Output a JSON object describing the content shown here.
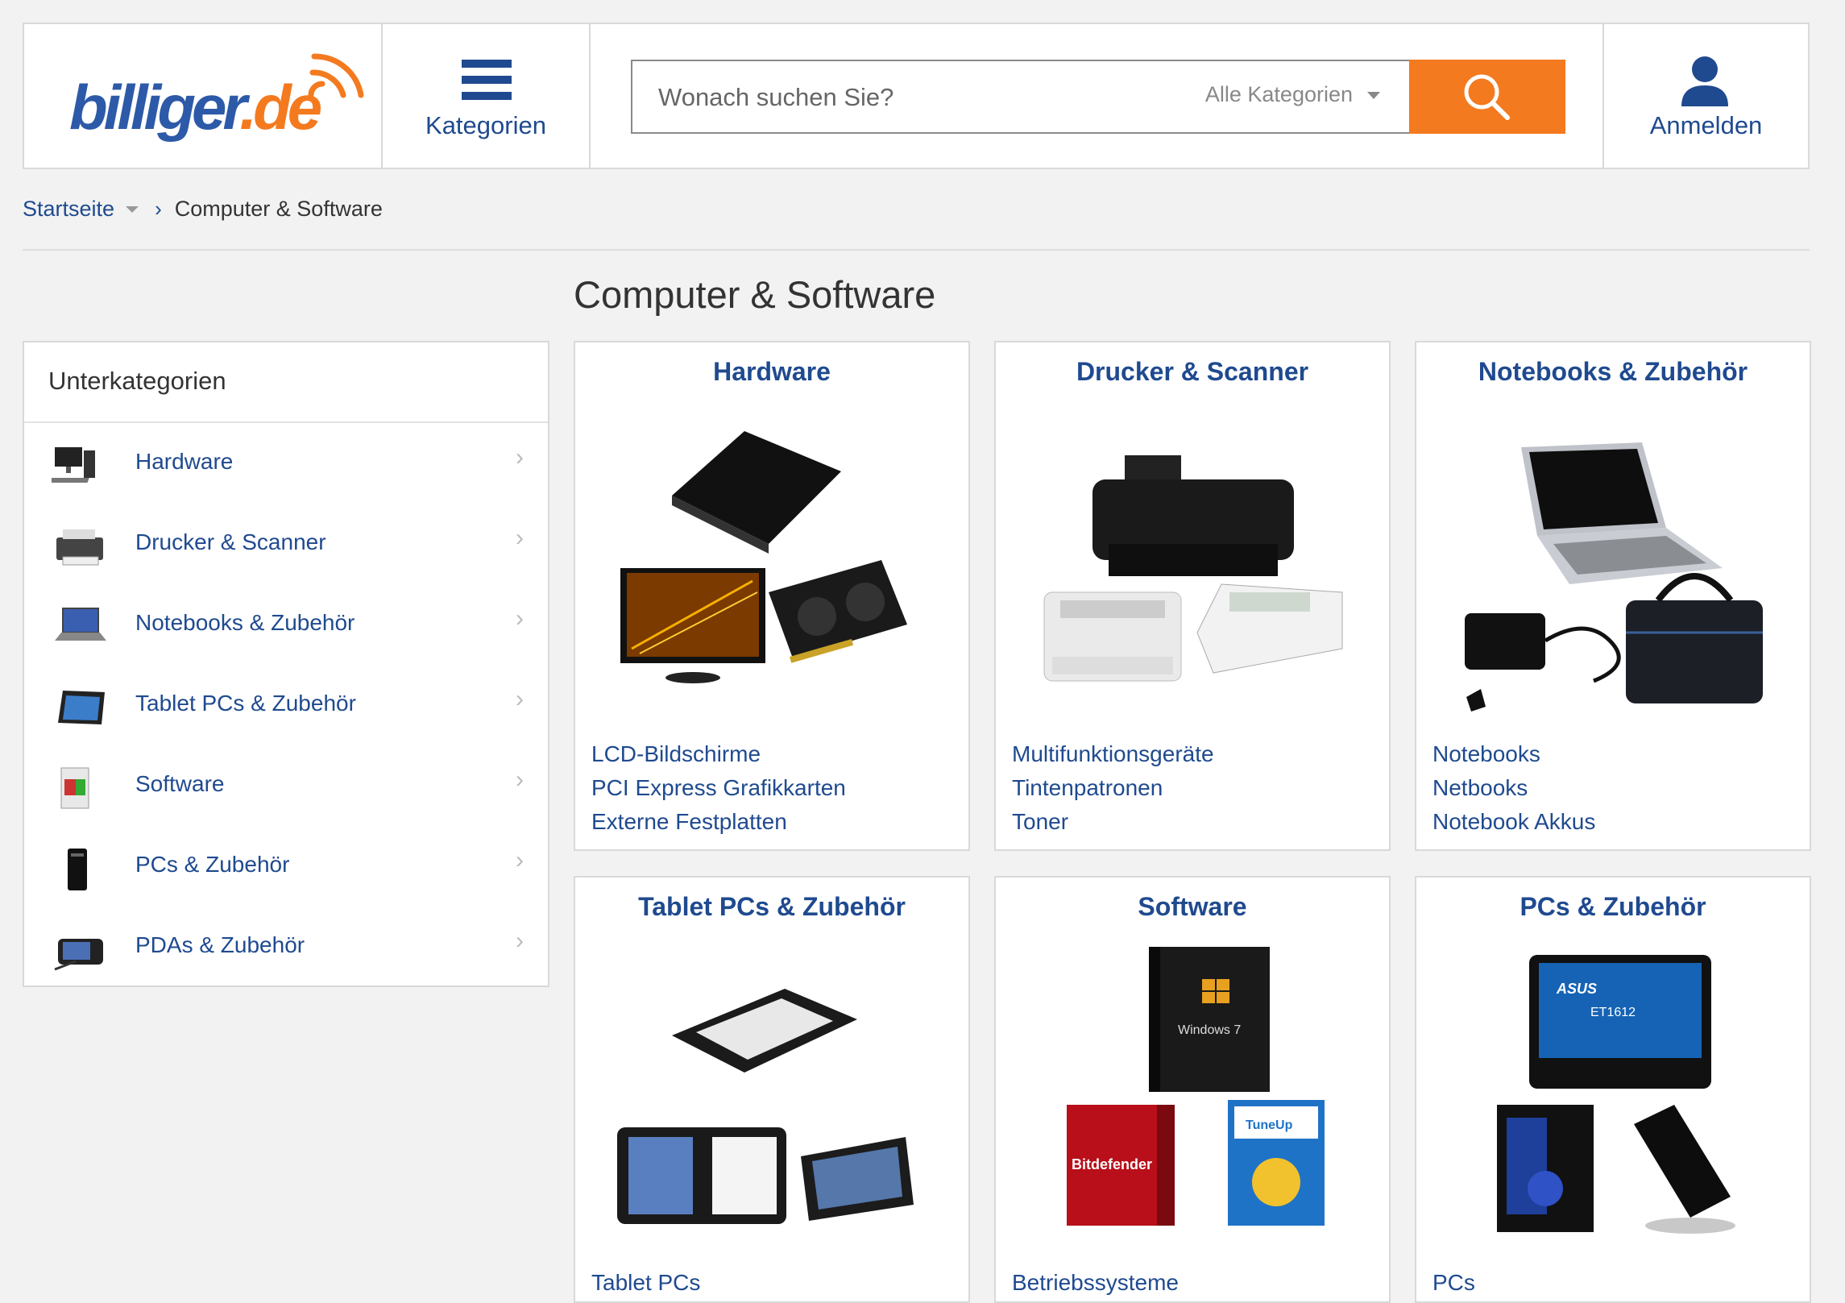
{
  "header": {
    "logo": {
      "main": "billiger",
      "dot": ".",
      "tld": "de"
    },
    "categories_label": "Kategorien",
    "search": {
      "placeholder": "Wonach suchen Sie?",
      "category_select": "Alle Kategorien"
    },
    "login_label": "Anmelden",
    "colors": {
      "brand_blue": "#1f4a8f",
      "accent_orange": "#f47a1f"
    }
  },
  "breadcrumb": {
    "home": "Startseite",
    "current": "Computer & Software"
  },
  "page_title": "Computer & Software",
  "sidebar": {
    "heading": "Unterkategorien",
    "items": [
      {
        "label": "Hardware",
        "icon": "desktop-pc-icon"
      },
      {
        "label": "Drucker & Scanner",
        "icon": "printer-icon"
      },
      {
        "label": "Notebooks & Zubehör",
        "icon": "laptop-icon"
      },
      {
        "label": "Tablet PCs & Zubehör",
        "icon": "tablet-icon"
      },
      {
        "label": "Software",
        "icon": "software-box-icon"
      },
      {
        "label": "PCs & Zubehör",
        "icon": "pc-tower-icon"
      },
      {
        "label": "PDAs & Zubehör",
        "icon": "pda-icon"
      }
    ]
  },
  "cards": [
    {
      "title": "Hardware",
      "links": [
        "LCD-Bildschirme",
        "PCI Express Grafikkarten",
        "Externe Festplatten"
      ]
    },
    {
      "title": "Drucker & Scanner",
      "links": [
        "Multifunktionsgeräte",
        "Tintenpatronen",
        "Toner"
      ]
    },
    {
      "title": "Notebooks & Zubehör",
      "links": [
        "Notebooks",
        "Netbooks",
        "Notebook Akkus"
      ]
    },
    {
      "title": "Tablet PCs & Zubehör",
      "links": [
        "Tablet PCs"
      ]
    },
    {
      "title": "Software",
      "links": [
        "Betriebssysteme"
      ],
      "image_text": {
        "win": "Windows 7",
        "bd": "Bitdefender",
        "tu": "TuneUp"
      }
    },
    {
      "title": "PCs & Zubehör",
      "links": [
        "PCs"
      ],
      "image_text": {
        "asus": "ASUS",
        "model": "ET1612"
      }
    }
  ]
}
